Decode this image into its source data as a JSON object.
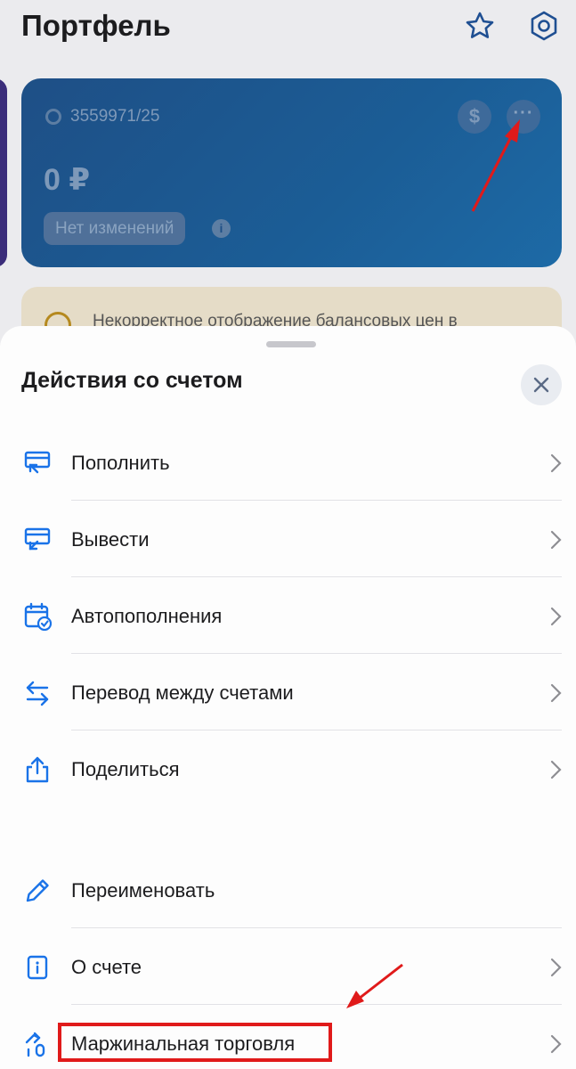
{
  "background": {
    "title": "Портфель",
    "account_number": "3559971/25",
    "balance": "0 ₽",
    "change_badge": "Нет изменений",
    "warning_text": "Некорректное отображение балансовых цен в"
  },
  "sheet": {
    "title": "Действия со счетом",
    "items": [
      {
        "label": "Пополнить",
        "icon": "deposit-icon"
      },
      {
        "label": "Вывести",
        "icon": "withdraw-icon"
      },
      {
        "label": "Автопополнения",
        "icon": "calendar-check-icon"
      },
      {
        "label": "Перевод между счетами",
        "icon": "transfer-arrows-icon"
      },
      {
        "label": "Поделиться",
        "icon": "share-icon"
      },
      {
        "label": "Переименовать",
        "icon": "pencil-icon"
      },
      {
        "label": "О счете",
        "icon": "info-card-icon"
      },
      {
        "label": "Маржинальная торговля",
        "icon": "margin-trading-icon"
      }
    ]
  },
  "colors": {
    "accent": "#1a73e8",
    "annotation": "#e01a1a"
  }
}
